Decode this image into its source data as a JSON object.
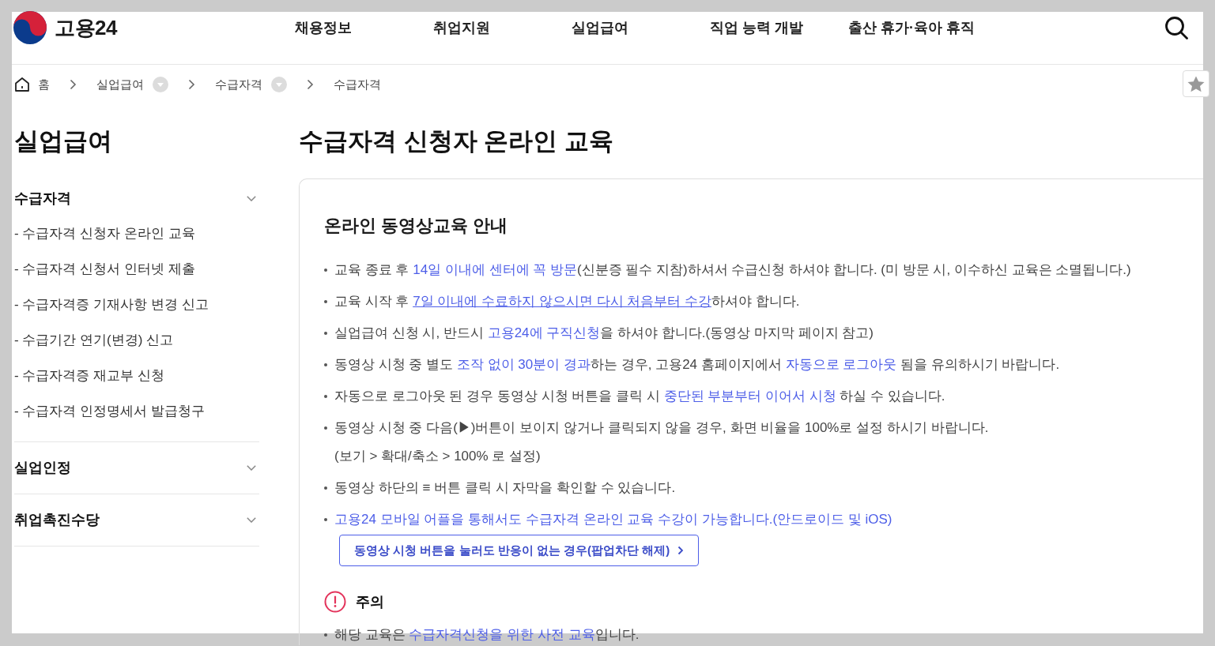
{
  "header": {
    "logo_text": "고용24",
    "nav": [
      "채용정보",
      "취업지원",
      "실업급여",
      "직업 능력 개발",
      "출산 휴가·육아 휴직"
    ]
  },
  "breadcrumb": [
    {
      "kind": "home",
      "label": "홈"
    },
    {
      "kind": "menu",
      "label": "실업급여"
    },
    {
      "kind": "menu",
      "label": "수급자격"
    },
    {
      "kind": "current",
      "label": "수급자격"
    }
  ],
  "sidebar": {
    "title": "실업급여",
    "sections": [
      {
        "label": "수급자격",
        "children": [
          "- 수급자격 신청자 온라인 교육",
          "- 수급자격 신청서 인터넷 제출",
          "- 수급자격증 기재사항 변경 신고",
          "- 수급기간 연기(변경) 신고",
          "- 수급자격증 재교부 신청",
          "- 수급자격 인정명세서 발급청구"
        ]
      },
      {
        "label": "실업인정"
      },
      {
        "label": "취업촉진수당"
      }
    ]
  },
  "main": {
    "title": "수급자격 신청자 온라인 교육",
    "card": {
      "heading": "온라인 동영상교육 안내",
      "bullets": [
        {
          "segments": [
            {
              "kind": "plain",
              "text": "교육 종료 후 "
            },
            {
              "kind": "highlight",
              "text": "14일 이내에 센터에 꼭 방문"
            },
            {
              "kind": "plain",
              "text": "(신분증 필수 지참)하셔서 수급신청 하셔야 합니다. (미 방문 시, 이수하신 교육은 소멸됩니다.)"
            }
          ]
        },
        {
          "segments": [
            {
              "kind": "plain",
              "text": "교육 시작 후 "
            },
            {
              "kind": "link",
              "text": "7일 이내에 수료하지 않으시면 다시 처음부터 수강"
            },
            {
              "kind": "plain",
              "text": "하셔야 합니다."
            }
          ]
        },
        {
          "segments": [
            {
              "kind": "plain",
              "text": "실업급여 신청 시, 반드시 "
            },
            {
              "kind": "highlight",
              "text": "고용24에 구직신청"
            },
            {
              "kind": "plain",
              "text": "을 하셔야 합니다.(동영상 마지막 페이지 참고)"
            }
          ]
        },
        {
          "segments": [
            {
              "kind": "plain",
              "text": "동영상 시청 중 별도 "
            },
            {
              "kind": "highlight",
              "text": "조작 없이 30분이 경과"
            },
            {
              "kind": "plain",
              "text": "하는 경우, 고용24 홈페이지에서 "
            },
            {
              "kind": "highlight",
              "text": "자동으로 로그아웃"
            },
            {
              "kind": "plain",
              "text": " 됨을 유의하시기 바랍니다."
            }
          ]
        },
        {
          "segments": [
            {
              "kind": "plain",
              "text": "자동으로 로그아웃 된 경우 동영상 시청 버튼을 클릭 시 "
            },
            {
              "kind": "highlight",
              "text": "중단된 부분부터 이어서 시청"
            },
            {
              "kind": "plain",
              "text": " 하실 수 있습니다."
            }
          ]
        },
        {
          "segments": [
            {
              "kind": "plain",
              "text": "동영상 시청 중 다음(▶)버튼이 보이지 않거나 클릭되지 않을 경우, 화면 비율을 100%로 설정 하시기 바랍니다."
            }
          ],
          "note": "(보기 > 확대/축소 > 100% 로 설정)"
        },
        {
          "segments": [
            {
              "kind": "plain",
              "text": "동영상 하단의 ≡ 버튼 클릭 시 자막을 확인할 수 있습니다."
            }
          ]
        },
        {
          "segments": [
            {
              "kind": "highlight",
              "text": "고용24 모바일 어플을 통해서도 수급자격 온라인 교육 수강이 가능합니다.(안드로이드 및 iOS)"
            }
          ]
        }
      ],
      "button": "동영상 시청 버튼을 눌러도 반응이 없는 경우(팝업차단 해제)",
      "notice": {
        "heading": "주의",
        "bullets": [
          {
            "segments": [
              {
                "kind": "plain",
                "text": "해당 교육은 "
              },
              {
                "kind": "highlight",
                "text": "수급자격신청을 위한 사전 교육"
              },
              {
                "kind": "plain",
                "text": "입니다."
              }
            ]
          }
        ]
      }
    }
  }
}
